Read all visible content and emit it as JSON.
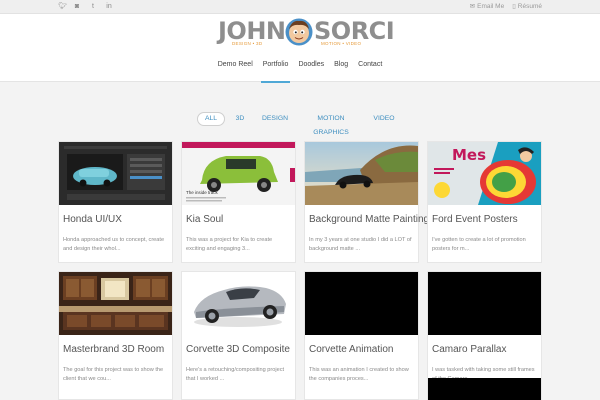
{
  "topbar": {
    "social_icons": [
      "twitter-icon",
      "instagram-icon",
      "tumblr-icon",
      "linkedin-icon"
    ],
    "email_label": "Email Me",
    "resume_label": "Résumé"
  },
  "logo": {
    "first": "JOHN",
    "last": "SORCI",
    "tagline_left": "DESIGN  •  3D",
    "tagline_right": "MOTION  •  VIDEO"
  },
  "nav": {
    "items": [
      "Demo Reel",
      "Portfolio",
      "Doodles",
      "Blog",
      "Contact"
    ],
    "active": "Portfolio"
  },
  "filters": {
    "items": [
      "ALL",
      "3D",
      "DESIGN",
      "MOTION GRAPHICS",
      "VIDEO"
    ],
    "active": "ALL"
  },
  "cards": [
    {
      "title": "Honda UI/UX",
      "desc": "Honda approached us to concept, create and design their whol..."
    },
    {
      "title": "Kia Soul",
      "desc": "This was a project for Kia to create exciting and engaging 3..."
    },
    {
      "title": "Background Matte Painting",
      "desc": "In my 3 years at one studio I did a LOT of background matte ..."
    },
    {
      "title": "Ford Event Posters",
      "desc": "I've gotten to create a lot of promotion posters for m..."
    },
    {
      "title": "Masterbrand 3D Room",
      "desc": "The goal for this project was to show the client that we cou..."
    },
    {
      "title": "Corvette 3D Composite",
      "desc": "Here's a retouching/compositing project that I worked ..."
    },
    {
      "title": "Corvette Animation",
      "desc": "This was an animation I created to show the companies proces..."
    },
    {
      "title": "Camaro Parallax",
      "desc": "I was tasked with taking some still frames of the Camaro ..."
    }
  ],
  "thumb_texts": {
    "kia_caption": "The inside track",
    "ford_poster": "Mes"
  },
  "colors": {
    "accent": "#4fa8d6",
    "filter_text": "#3f8fc0",
    "logo_gray": "#8e8e8e",
    "tagline_orange": "#e59a3a"
  }
}
